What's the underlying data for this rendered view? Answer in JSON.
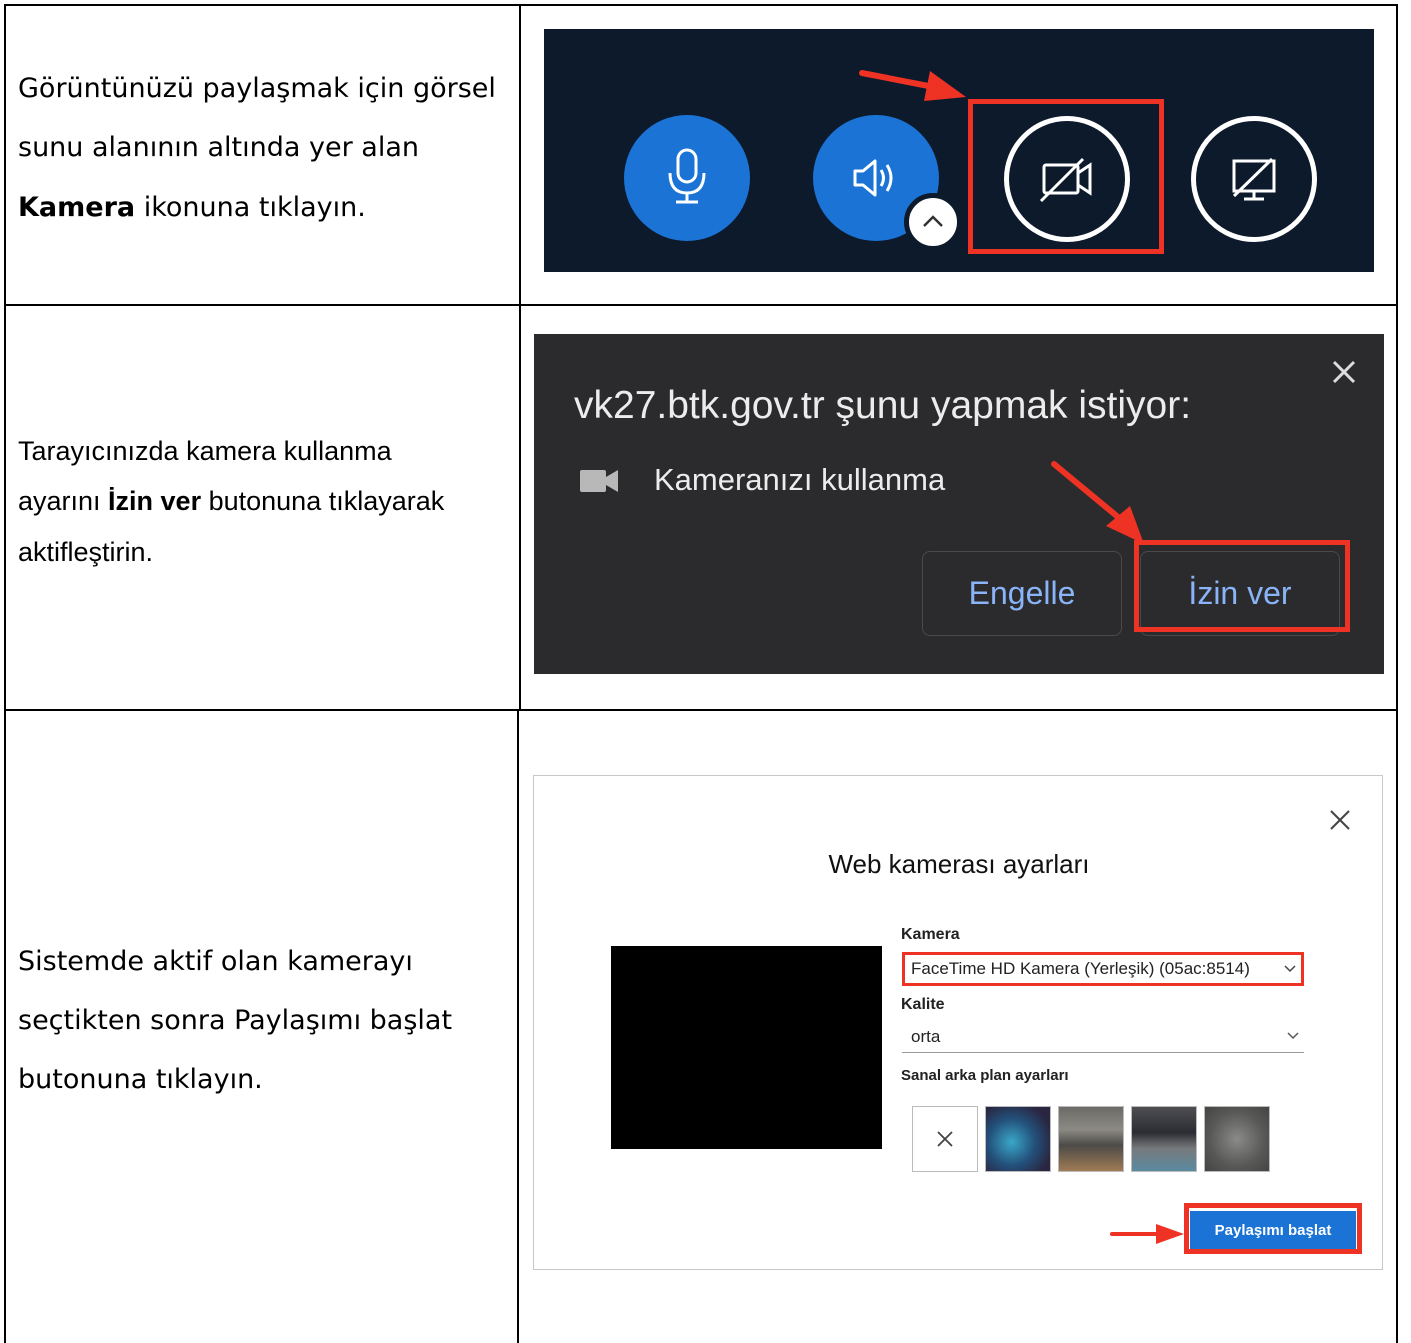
{
  "rows": [
    {
      "instruction_lines": [
        "Görüntünüzü paylaşmak için görsel",
        "sunu alanının altında yer alan"
      ],
      "instruction_bold": "Kamera",
      "instruction_rest": " ikonuna tıklayın."
    },
    {
      "instruction_line1": "Tarayıcınızda kamera kullanma",
      "instruction_pre": "ayarını ",
      "instruction_bold": "İzin ver",
      "instruction_post": " butonuna tıklayarak",
      "instruction_line3": "aktifleştirin."
    },
    {
      "instruction_lines": [
        "Sistemde aktif olan kamerayı",
        "seçtikten sonra Paylaşımı başlat",
        "butonuna tıklayın."
      ]
    }
  ],
  "toolbar": {
    "buttons": [
      {
        "icon": "microphone-icon"
      },
      {
        "icon": "speaker-icon"
      },
      {
        "icon": "camera-off-icon"
      },
      {
        "icon": "screen-share-off-icon"
      }
    ],
    "highlight_color": "#ee3224",
    "background": "#0c1a2b",
    "accent": "#1b73d6"
  },
  "permission_dialog": {
    "title": "vk27.btk.gov.tr şunu yapmak istiyor:",
    "request": "Kameranızı kullanma",
    "block_button": "Engelle",
    "allow_button": "İzin ver"
  },
  "webcam_settings": {
    "title": "Web kamerası ayarları",
    "camera_label": "Kamera",
    "camera_value": "FaceTime HD Kamera (Yerleşik) (05ac:8514)",
    "quality_label": "Kalite",
    "quality_value": "orta",
    "background_label": "Sanal arka plan ayarları",
    "start_button": "Paylaşımı başlat"
  }
}
